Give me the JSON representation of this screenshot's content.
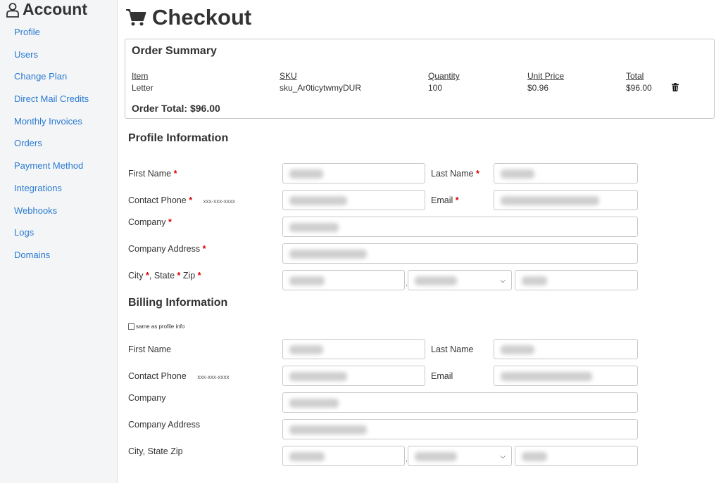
{
  "sidebar": {
    "title": "Account",
    "items": [
      "Profile",
      "Users",
      "Change Plan",
      "Direct Mail Credits",
      "Monthly Invoices",
      "Orders",
      "Payment Method",
      "Integrations",
      "Webhooks",
      "Logs",
      "Domains"
    ]
  },
  "page": {
    "title": "Checkout"
  },
  "summary": {
    "title": "Order Summary",
    "headers": {
      "item": "Item",
      "sku": "SKU",
      "quantity": "Quantity",
      "unit_price": "Unit Price",
      "total": "Total"
    },
    "row": {
      "item": "Letter",
      "sku": "sku_Ar0ticytwmyDUR",
      "quantity": "100",
      "unit_price": "$0.96",
      "total": "$96.00"
    },
    "order_total": "Order Total: $96.00"
  },
  "profile": {
    "heading": "Profile Information",
    "first_name": "First Name",
    "last_name": "Last Name",
    "contact_phone": "Contact Phone",
    "phone_hint": "xxx-xxx-xxxx",
    "email": "Email",
    "company": "Company",
    "company_address": "Company Address",
    "city": "City",
    "state": "State",
    "zip": "Zip",
    "required_mark": "*"
  },
  "billing": {
    "heading": "Billing Information",
    "same_as_profile": "same as profile info",
    "first_name": "First Name",
    "last_name": "Last Name",
    "contact_phone": "Contact Phone",
    "phone_hint": "xxx-xxx-xxxx",
    "email": "Email",
    "company": "Company",
    "company_address": "Company Address",
    "city_state_zip": "City, State Zip"
  },
  "icons": {
    "account": "user-outline-icon",
    "checkout": "shopping-cart-icon",
    "remove": "trash-icon",
    "dropdown": "chevron-down-icon"
  },
  "colors": {
    "link": "#2a7bd1",
    "required": "#dd0000",
    "sidebar_bg": "#f4f5f7"
  }
}
